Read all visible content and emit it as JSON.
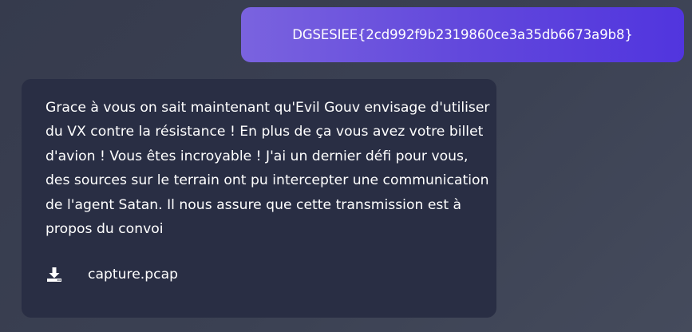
{
  "chat": {
    "user_message": "DGSESIEE{2cd992f9b2319860ce3a35db6673a9b8}",
    "bot_message": "Grace à vous on sait maintenant qu'Evil Gouv envisage d'utiliser du VX contre la résistance ! En plus de ça vous avez votre billet d'avion ! Vous êtes incroyable ! J'ai un dernier défi pour vous, des sources sur le terrain ont pu intercepter une communication de l'agent Satan. Il nous assure que cette transmission est à propos du convoi",
    "attachment": {
      "icon": "download-icon",
      "file_name": "capture.pcap"
    }
  },
  "colors": {
    "background": "#3b4153",
    "user_bubble_start": "#7a63df",
    "user_bubble_end": "#5135de",
    "bot_bubble": "#292e44",
    "text": "#ffffff"
  }
}
